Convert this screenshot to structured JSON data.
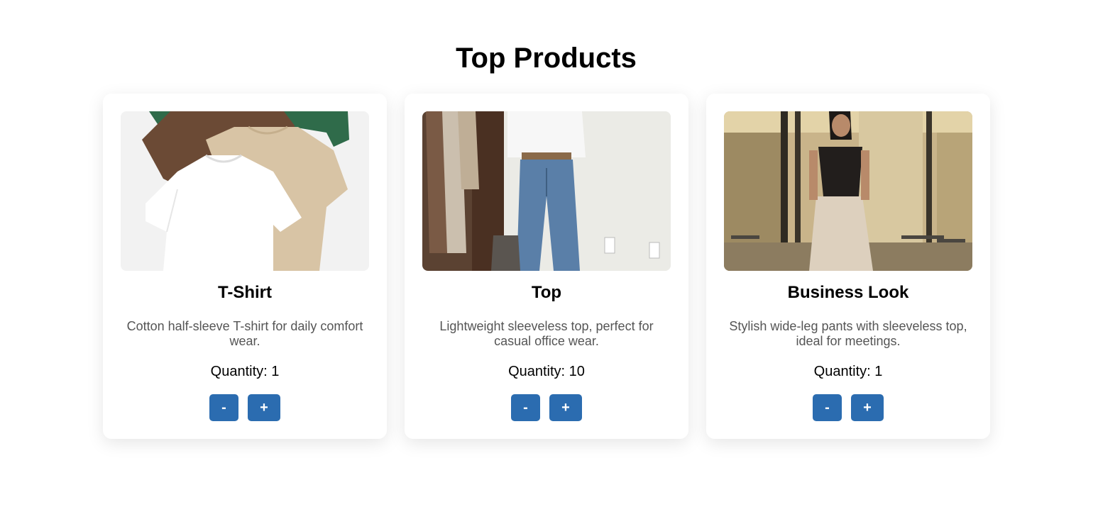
{
  "page": {
    "title": "Top Products"
  },
  "products": [
    {
      "name": "T-Shirt",
      "description": "Cotton half-sleeve T-shirt for daily comfort wear.",
      "quantity_text": "Quantity: 1",
      "quantity": 1,
      "decrement_label": "-",
      "increment_label": "+",
      "image": "folded-t-shirts-photo"
    },
    {
      "name": "Top",
      "description": "Lightweight sleeveless top, perfect for casual office wear.",
      "quantity_text": "Quantity: 10",
      "quantity": 10,
      "decrement_label": "-",
      "increment_label": "+",
      "image": "white-shirt-jeans-outfit-photo"
    },
    {
      "name": "Business Look",
      "description": "Stylish wide-leg pants with sleeveless top, ideal for meetings.",
      "quantity_text": "Quantity: 1",
      "quantity": 1,
      "decrement_label": "-",
      "increment_label": "+",
      "image": "business-outfit-woman-photo"
    }
  ],
  "colors": {
    "button": "#2b6cb0",
    "button_text": "#ffffff",
    "description_text": "#555555",
    "card_background": "#ffffff"
  }
}
